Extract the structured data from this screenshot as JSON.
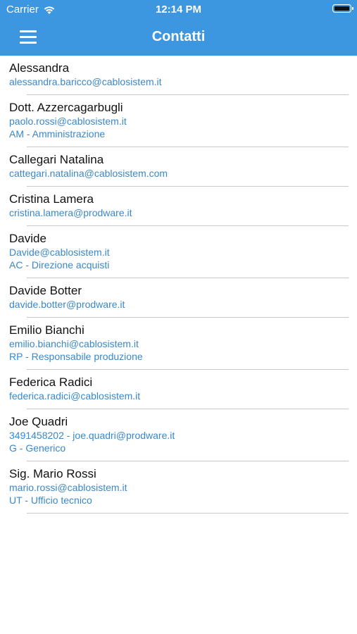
{
  "status_bar": {
    "carrier": "Carrier",
    "time": "12:14 PM"
  },
  "nav": {
    "title": "Contatti",
    "menu_icon": "hamburger-menu-icon"
  },
  "colors": {
    "header": "#3c97e0",
    "link": "#3a88c8"
  },
  "contacts": [
    {
      "name": "Alessandra",
      "lines": [
        "alessandra.baricco@cablosistem.it"
      ]
    },
    {
      "name": "Dott. Azzercagarbugli",
      "lines": [
        "paolo.rossi@cablosistem.it",
        "AM - Amministrazione"
      ]
    },
    {
      "name": "Callegari Natalina",
      "lines": [
        "cattegari.natalina@cablosistem.com"
      ]
    },
    {
      "name": "Cristina Lamera",
      "lines": [
        "cristina.lamera@prodware.it"
      ]
    },
    {
      "name": "Davide",
      "lines": [
        "Davide@cablosistem.it",
        "AC - Direzione acquisti"
      ]
    },
    {
      "name": "Davide Botter",
      "lines": [
        "davide.botter@prodware.it"
      ]
    },
    {
      "name": "Emilio Bianchi",
      "lines": [
        "emilio.bianchi@cablosistem.it",
        "RP - Responsabile produzione"
      ]
    },
    {
      "name": "Federica Radici",
      "lines": [
        "federica.radici@cablosistem.it"
      ]
    },
    {
      "name": "Joe Quadri",
      "lines": [
        "3491458202 - joe.quadri@prodware.it",
        "G - Generico"
      ]
    },
    {
      "name": "Sig. Mario Rossi",
      "lines": [
        "mario.rossi@cablosistem.it",
        "UT - Ufficio tecnico"
      ]
    }
  ]
}
